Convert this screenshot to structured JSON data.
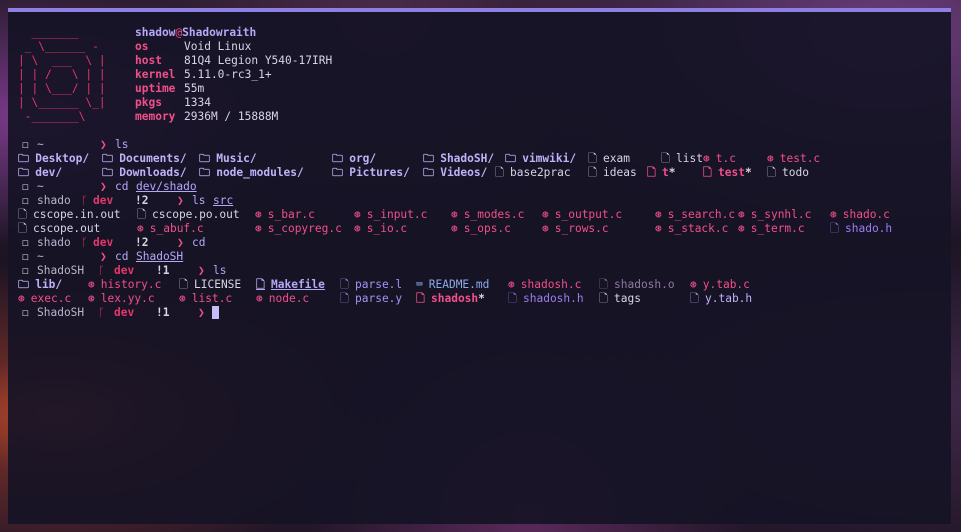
{
  "fetch": {
    "ascii_art": [
      "  _______",
      " _ \\______ -",
      "| \\  ___  \\ |",
      "| | /   \\ | |",
      "| | \\___/ | |",
      "| \\______ \\_|",
      " -_______\\"
    ],
    "user": "shadow",
    "at": "@",
    "hostname": "Shadowraith",
    "info": [
      {
        "label": "os",
        "value": "Void Linux"
      },
      {
        "label": "host",
        "value": "81Q4 Legion Y540-17IRH"
      },
      {
        "label": "kernel",
        "value": "5.11.0-rc3_1+"
      },
      {
        "label": "uptime",
        "value": "55m"
      },
      {
        "label": "pkgs",
        "value": "1334"
      },
      {
        "label": "memory",
        "value": "2936M / 15888M"
      }
    ]
  },
  "icons": {
    "prompt": "◻",
    "folder": "🗀",
    "file": "🗋",
    "c_file": "⊛",
    "markdown": "⌨",
    "branch": "ᚴ",
    "arrow": "❯",
    "exec_suffix": "*"
  },
  "colors": {
    "accent": "#8e7fe3",
    "pink": "#f0508a",
    "lavender": "#b6a8f7",
    "background": "#161326"
  },
  "prompts": [
    {
      "cwd": "~",
      "branch": "",
      "status": "",
      "cmd": "ls",
      "arg": ""
    },
    {
      "cwd": "~",
      "branch": "",
      "status": "",
      "cmd": "cd",
      "arg": "dev/shado"
    },
    {
      "cwd": "shado",
      "branch": "dev",
      "status": "!2",
      "cmd": "ls",
      "arg": "src"
    },
    {
      "cwd": "shado",
      "branch": "dev",
      "status": "!2",
      "cmd": "cd",
      "arg": ""
    },
    {
      "cwd": "~",
      "branch": "",
      "status": "",
      "cmd": "cd",
      "arg": "ShadoSH"
    },
    {
      "cwd": "ShadoSH",
      "branch": "dev",
      "status": "!1",
      "cmd": "ls",
      "arg": ""
    },
    {
      "cwd": "ShadoSH",
      "branch": "dev",
      "status": "!1",
      "cmd": "",
      "arg": ""
    }
  ],
  "listing_home": [
    [
      {
        "name": "Desktop/",
        "kind": "dir"
      },
      {
        "name": "Documents/",
        "kind": "dir"
      },
      {
        "name": "Music/",
        "kind": "dir"
      },
      {
        "name": "org/",
        "kind": "dir"
      },
      {
        "name": "ShadoSH/",
        "kind": "dir"
      },
      {
        "name": "vimwiki/",
        "kind": "dir"
      },
      {
        "name": "exam",
        "kind": "file"
      },
      {
        "name": "list",
        "kind": "file"
      },
      {
        "name": "t.c",
        "kind": "c"
      },
      {
        "name": "test.c",
        "kind": "c"
      }
    ],
    [
      {
        "name": "dev/",
        "kind": "dir"
      },
      {
        "name": "Downloads/",
        "kind": "dir"
      },
      {
        "name": "node_modules/",
        "kind": "dir"
      },
      {
        "name": "Pictures/",
        "kind": "dir"
      },
      {
        "name": "Videos/",
        "kind": "dir"
      },
      {
        "name": "base2prac",
        "kind": "file"
      },
      {
        "name": "ideas",
        "kind": "file"
      },
      {
        "name": "t",
        "kind": "exec"
      },
      {
        "name": "test",
        "kind": "exec"
      },
      {
        "name": "todo",
        "kind": "file"
      }
    ]
  ],
  "listing_src": [
    [
      {
        "name": "cscope.in.out",
        "kind": "file"
      },
      {
        "name": "cscope.po.out",
        "kind": "file"
      },
      {
        "name": "s_bar.c",
        "kind": "c"
      },
      {
        "name": "s_input.c",
        "kind": "c"
      },
      {
        "name": "s_modes.c",
        "kind": "c"
      },
      {
        "name": "s_output.c",
        "kind": "c"
      },
      {
        "name": "s_search.c",
        "kind": "c"
      },
      {
        "name": "s_synhl.c",
        "kind": "c"
      },
      {
        "name": "shado.c",
        "kind": "c"
      }
    ],
    [
      {
        "name": "cscope.out",
        "kind": "file"
      },
      {
        "name": "s_abuf.c",
        "kind": "c"
      },
      {
        "name": "s_copyreg.c",
        "kind": "c"
      },
      {
        "name": "s_io.c",
        "kind": "c"
      },
      {
        "name": "s_ops.c",
        "kind": "c"
      },
      {
        "name": "s_rows.c",
        "kind": "c"
      },
      {
        "name": "s_stack.c",
        "kind": "c"
      },
      {
        "name": "s_term.c",
        "kind": "c"
      },
      {
        "name": "shado.h",
        "kind": "h"
      }
    ]
  ],
  "listing_shadosh": [
    [
      {
        "name": "lib/",
        "kind": "dir"
      },
      {
        "name": "history.c",
        "kind": "c"
      },
      {
        "name": "LICENSE",
        "kind": "file"
      },
      {
        "name": "Makefile",
        "kind": "make"
      },
      {
        "name": "parse.l",
        "kind": "src"
      },
      {
        "name": "README.md",
        "kind": "md"
      },
      {
        "name": "shadosh.c",
        "kind": "c"
      },
      {
        "name": "shadosh.o",
        "kind": "obj"
      },
      {
        "name": "y.tab.c",
        "kind": "c"
      }
    ],
    [
      {
        "name": "exec.c",
        "kind": "c"
      },
      {
        "name": "lex.yy.c",
        "kind": "c"
      },
      {
        "name": "list.c",
        "kind": "c"
      },
      {
        "name": "node.c",
        "kind": "c"
      },
      {
        "name": "parse.y",
        "kind": "src"
      },
      {
        "name": "shadosh",
        "kind": "exec"
      },
      {
        "name": "shadosh.h",
        "kind": "h"
      },
      {
        "name": "tags",
        "kind": "file"
      },
      {
        "name": "y.tab.h",
        "kind": "ytab"
      }
    ]
  ]
}
